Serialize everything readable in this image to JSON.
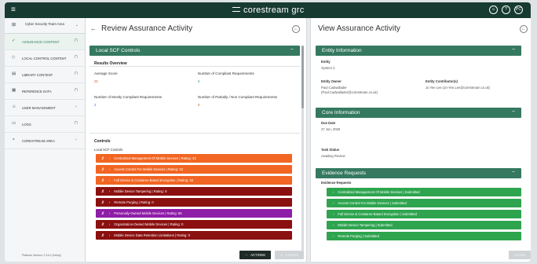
{
  "app": {
    "brand": "corestream grc"
  },
  "topbar": {
    "icon_a": "☺",
    "icon_b": "?",
    "initials": "PC"
  },
  "sidebar": {
    "header": "Cyber Security Team Area",
    "items": [
      {
        "label": "ASSURANCE CONTENT",
        "active": true
      },
      {
        "label": "LOCAL CONTROL CONTENT"
      },
      {
        "label": "LIBRARY CONTENT"
      },
      {
        "label": "REFERENCE DATA"
      },
      {
        "label": "USER MANAGEMENT"
      },
      {
        "label": "LOGS"
      },
      {
        "label": "CORESTREAM AREA"
      }
    ],
    "footer": "Platform Version: 2.14.0 (Setup)"
  },
  "left_panel": {
    "title": "Review Assurance Activity",
    "section_title": "Local SCF Controls",
    "overview_title": "Results Overview",
    "metrics": [
      {
        "label": "Average Score",
        "value": "21"
      },
      {
        "label": "Number of Compliant Requirements",
        "value": "5"
      },
      {
        "label": "Number of Mostly Compliant Requirements",
        "value": "2"
      },
      {
        "label": "Number of Partially / Non Compliant Requirements",
        "value": "8"
      }
    ],
    "controls_title": "Controls",
    "controls_label": "Local SCF Controls",
    "controls": [
      {
        "label": "Centralized Management Of Mobile Devices | Rating: 33",
        "color": "#f26522"
      },
      {
        "label": "Access Control For Mobile Devices | Rating: 33",
        "color": "#f26522"
      },
      {
        "label": "Full Device & Container-Based Encryption | Rating: 33",
        "color": "#f26522"
      },
      {
        "label": "Mobile Device Tampering | Rating: 0",
        "color": "#8b1010"
      },
      {
        "label": "Remote Purging | Rating: 0",
        "color": "#8b1010"
      },
      {
        "label": "Personally-Owned Mobile Devices | Rating: 66",
        "color": "#8e1da8"
      },
      {
        "label": "Organization-Owned Mobile Devices | Rating: 0",
        "color": "#8b1010"
      },
      {
        "label": "Mobile Device Data Retention Limitations | Rating: 0",
        "color": "#8b1010"
      }
    ],
    "actions_label": "ACTIONS",
    "cancel_label": "CANCEL"
  },
  "right_panel": {
    "title": "View Assurance Activity",
    "entity_section": "Entity Information",
    "entity_label": "Entity",
    "entity_value": "System 2",
    "owner_label": "Entity Owner",
    "owner_name": "Paul Cadwallader",
    "owner_email": "(Paul.Cadwallader@corestream.co.uk)",
    "contrib_label": "Entity Contributor(s)",
    "contrib_value": "Jo Yee Lee (Jo-Yee.Lee@corestream.co.uk)",
    "core_section": "Core Information",
    "due_label": "Due Date",
    "due_value": "27 Jun, 2026",
    "status_label": "Task Status",
    "status_value": "Awaiting Review",
    "evidence_section": "Evidence Requests",
    "evidence_label": "Evidence Requests",
    "evidence": [
      "Centralized Management Of Mobile Devices | Submitted",
      "Access Control For Mobile Devices | Submitted",
      "Full Device & Container-Based Encryption | Submitted",
      "Mobile Device Tampering | Submitted",
      "Remote Purging | Submitted"
    ],
    "close_label": "CLOSE"
  },
  "colors": {
    "topbar": "#173b30",
    "section": "#357960",
    "evidence": "#2ea44f"
  }
}
